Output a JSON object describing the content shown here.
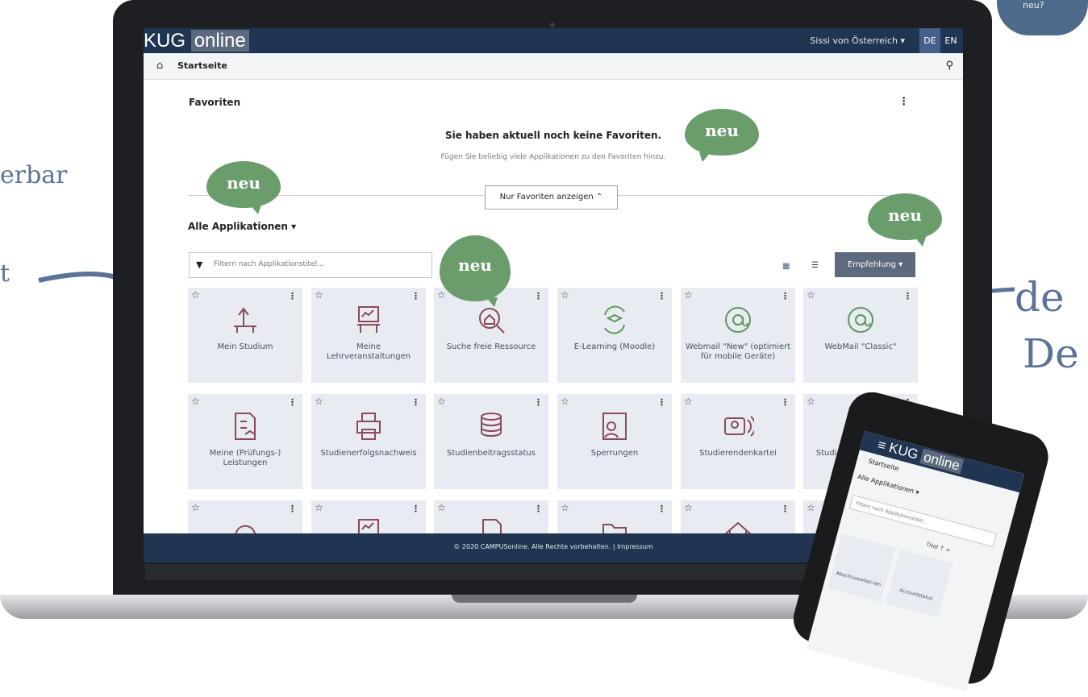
{
  "background": {
    "left_fragment_1": "erbar",
    "left_fragment_2": "t",
    "right_fragment_1": "de",
    "right_fragment_2": "De",
    "cloud_text": "neu?"
  },
  "header": {
    "logo_part1": "KUG",
    "logo_part2": "online",
    "user": "Sissi von Österreich ▾",
    "lang_de": "DE",
    "lang_en": "EN"
  },
  "nav": {
    "breadcrumb": "Startseite"
  },
  "favorites": {
    "title": "Favoriten",
    "empty_title": "Sie haben aktuell noch keine Favoriten.",
    "empty_sub": "Fügen Sie beliebig viele Applikationen zu den Favoriten hinzu.",
    "toggle_label": "Nur Favoriten anzeigen ⌃"
  },
  "apps": {
    "heading": "Alle Applikationen ▾",
    "filter_placeholder": "Filtern nach Applikationstitel...",
    "sort_label": "Empfehlung ▾",
    "tiles": [
      {
        "label": "Mein Studium",
        "icon": "desk-lamp-icon"
      },
      {
        "label": "Meine Lehrveranstaltungen",
        "icon": "board-icon"
      },
      {
        "label": "Suche freie Ressource",
        "icon": "house-search-icon"
      },
      {
        "label": "E-Learning (Moodle)",
        "icon": "graduation-sync-icon"
      },
      {
        "label": "Webmail \"New\" (optimiert für mobile Geräte)",
        "icon": "at-icon"
      },
      {
        "label": "WebMail \"Classic\"",
        "icon": "at-icon"
      },
      {
        "label": "Meine (Prüfungs-) Leistungen",
        "icon": "grades-icon"
      },
      {
        "label": "Studienerfolgsnachweis",
        "icon": "printer-icon"
      },
      {
        "label": "Studienbeitragsstatus",
        "icon": "coins-icon"
      },
      {
        "label": "Sperrungen",
        "icon": "locked-user-icon"
      },
      {
        "label": "Studierendenkartei",
        "icon": "id-card-icon"
      },
      {
        "label": "Studienbestätigungen",
        "icon": "certificate-icon"
      },
      {
        "label": "",
        "icon": "undo-icon"
      },
      {
        "label": "",
        "icon": "board-icon"
      },
      {
        "label": "",
        "icon": "document-icon"
      },
      {
        "label": "",
        "icon": "folder-icon"
      },
      {
        "label": "",
        "icon": "house-icon"
      },
      {
        "label": "",
        "icon": "sun-person-icon"
      }
    ]
  },
  "badges": {
    "new": "neu"
  },
  "footer": {
    "text": "© 2020 CAMPUSonline. Alle Rechte vorbehalten. | Impressum"
  },
  "phone": {
    "logo_part1": "≡ KUG",
    "logo_part2": "online",
    "breadcrumb": "Startseite",
    "all_apps": "Alle Applikationen ▾",
    "filter_placeholder": "Filtern nach Applikationstitel...",
    "sort_label": "Titel ↑ >",
    "tile1": "Abschlussarbei-ten",
    "tile2": "Accountstatus"
  },
  "colors": {
    "primary": "#1f3552",
    "accent": "#45608a",
    "tile": "#e8ebf2",
    "badge": "#6b9c6c",
    "icon": "#8a4a5c",
    "icon_green": "#5a9a5c"
  }
}
